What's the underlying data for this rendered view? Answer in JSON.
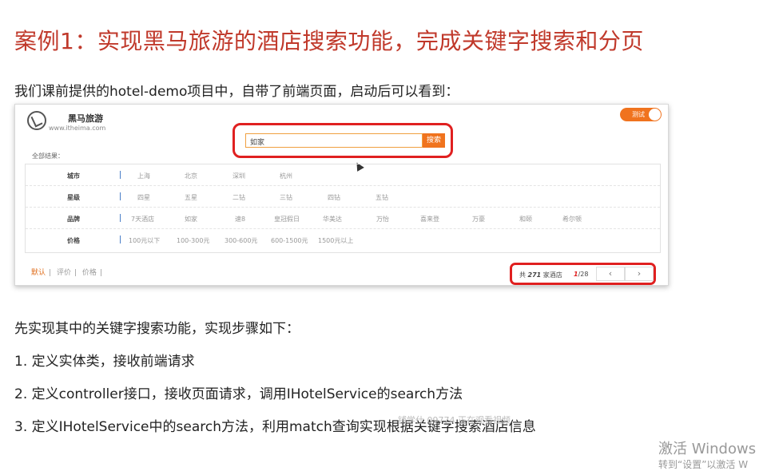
{
  "slide": {
    "title": "案例1：实现黑马旅游的酒店搜索功能，完成关键字搜索和分页",
    "intro": "我们课前提供的hotel-demo项目中，自带了前端页面，启动后可以看到：",
    "steps_heading": "先实现其中的关键字搜索功能，实现步骤如下：",
    "steps": [
      "1.   定义实体类，接收前端请求",
      "2.   定义controller接口，接收页面请求，调用IHotelService的search方法",
      "3.   定义IHotelService中的search方法，利用match查询实现根据关键字搜索酒店信息"
    ]
  },
  "app": {
    "brand_name": "黑马旅游",
    "brand_url": "www.itheima.com",
    "toggle_label": "测试",
    "search": {
      "value": "如家",
      "button": "搜索"
    },
    "all_results_label": "全部结果：",
    "filters": [
      {
        "name": "城市",
        "options": [
          "上海",
          "北京",
          "深圳",
          "杭州"
        ]
      },
      {
        "name": "星级",
        "options": [
          "四星",
          "五星",
          "二钻",
          "三钻",
          "四钻",
          "五钻"
        ]
      },
      {
        "name": "品牌",
        "options": [
          "7天酒店",
          "如家",
          "速8",
          "皇冠假日",
          "华美达",
          "万怡",
          "喜来登",
          "万豪",
          "和颐",
          "希尔顿"
        ]
      },
      {
        "name": "价格",
        "options": [
          "100元以下",
          "100-300元",
          "300-600元",
          "600-1500元",
          "1500元以上"
        ]
      }
    ],
    "sort": [
      "默认",
      "评价",
      "价格"
    ],
    "pagination": {
      "prefix": "共",
      "total": "271",
      "suffix": "家酒店",
      "current": "1",
      "pages": "/28",
      "prev": "‹",
      "next": "›"
    }
  },
  "overlay": {
    "mid_watermark": "铺学仕 09774 正在观看视频",
    "windows_line1": "激活 Windows",
    "windows_line2": "转到“设置”以激活 W"
  },
  "colors": {
    "title": "#c0392b",
    "accent": "#f0731e",
    "highlight": "#e02020"
  }
}
